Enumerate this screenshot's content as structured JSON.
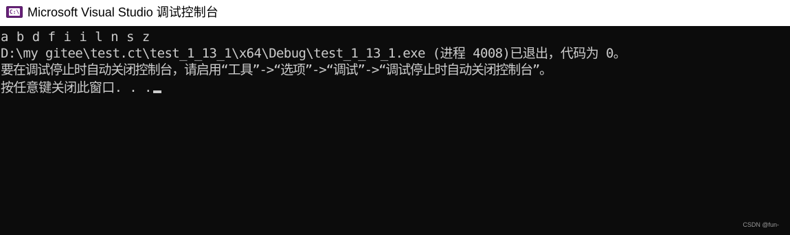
{
  "window": {
    "title": "Microsoft Visual Studio 调试控制台",
    "app_icon": "visual-studio-console-icon",
    "app_icon_glyph": "C:\\"
  },
  "console": {
    "lines": [
      "a b d f i i l n s z",
      "D:\\my gitee\\test.ct\\test_1_13_1\\x64\\Debug\\test_1_13_1.exe (进程 4008)已退出，代码为 0。",
      "要在调试停止时自动关闭控制台，请启用“工具”->“选项”->“调试”->“调试停止时自动关闭控制台”。",
      "按任意键关闭此窗口. . ."
    ],
    "background_color": "#0c0c0c",
    "text_color": "#cccccc"
  },
  "watermark": "CSDN @fun-"
}
